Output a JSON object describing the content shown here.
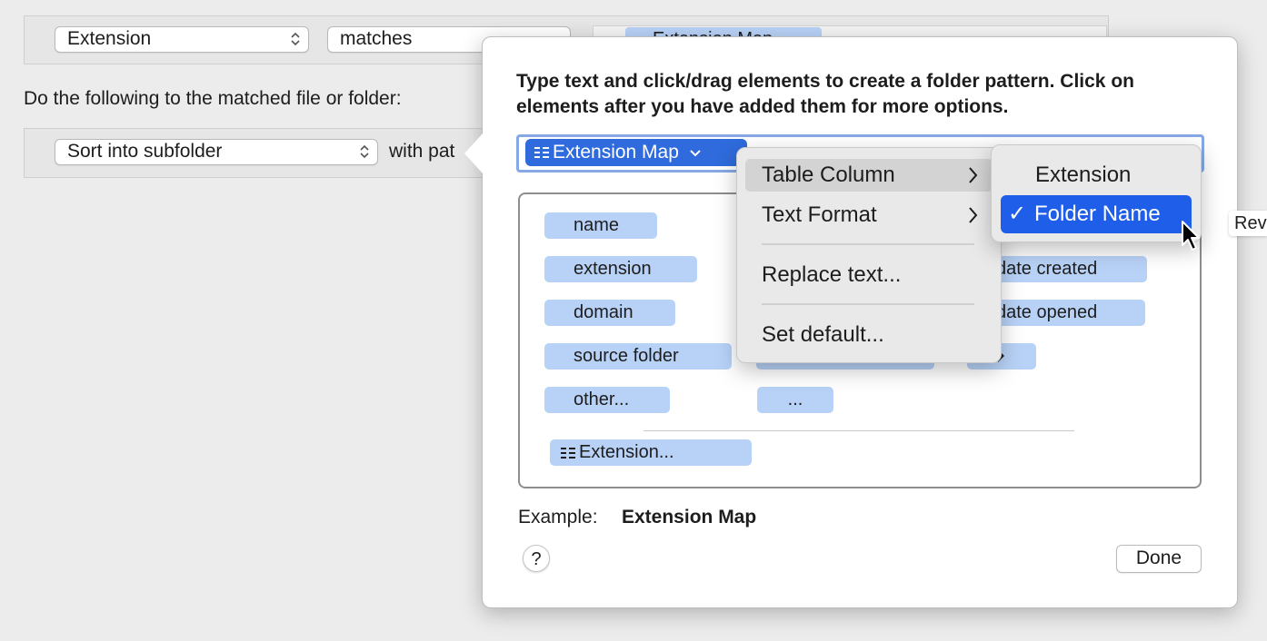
{
  "rule": {
    "attribute_value": "Extension",
    "operator_value": "matches",
    "criteria_token": "Extension Map",
    "action_heading": "Do the following to the matched file or folder:",
    "action_value": "Sort into subfolder",
    "with_pattern_label": "with pat"
  },
  "popover": {
    "instructions": "Type text and click/drag elements to create a folder pattern. Click on elements after you have added them for more options.",
    "pattern_token": "Extension Map",
    "elements": {
      "col1": [
        "name",
        "extension",
        "domain",
        "source folder",
        "other..."
      ],
      "col2_ellipsis": "...",
      "col3": [
        "date created",
        "date opened"
      ],
      "extension_table": "Extension..."
    },
    "example_label": "Example:",
    "example_value": "Extension Map",
    "help_label": "?",
    "done_label": "Done"
  },
  "token_menu": {
    "items": [
      {
        "label": "Table Column",
        "submenu": true
      },
      {
        "label": "Text Format",
        "submenu": true
      },
      {
        "label": "Replace text...",
        "submenu": false
      },
      {
        "label": "Set default...",
        "submenu": false
      }
    ]
  },
  "column_submenu": {
    "items": [
      {
        "label": "Extension",
        "checked": false
      },
      {
        "label": "Folder Name",
        "checked": true
      }
    ],
    "checkmark": "✓"
  },
  "offscreen_fragment": "Rev",
  "icons": {
    "grid": "table-grid-icon",
    "chevron": "chevron-down-icon",
    "submenu_arrow": "chevron-right-icon",
    "stepper": "updown-arrows-icon",
    "cursor": "mouse-pointer-icon"
  },
  "colors": {
    "selection_blue": "#1f5ee8",
    "token_blue": "#2f6bdc",
    "chip_blue": "#b8d2f7",
    "field_focus": "#86a9e6"
  }
}
